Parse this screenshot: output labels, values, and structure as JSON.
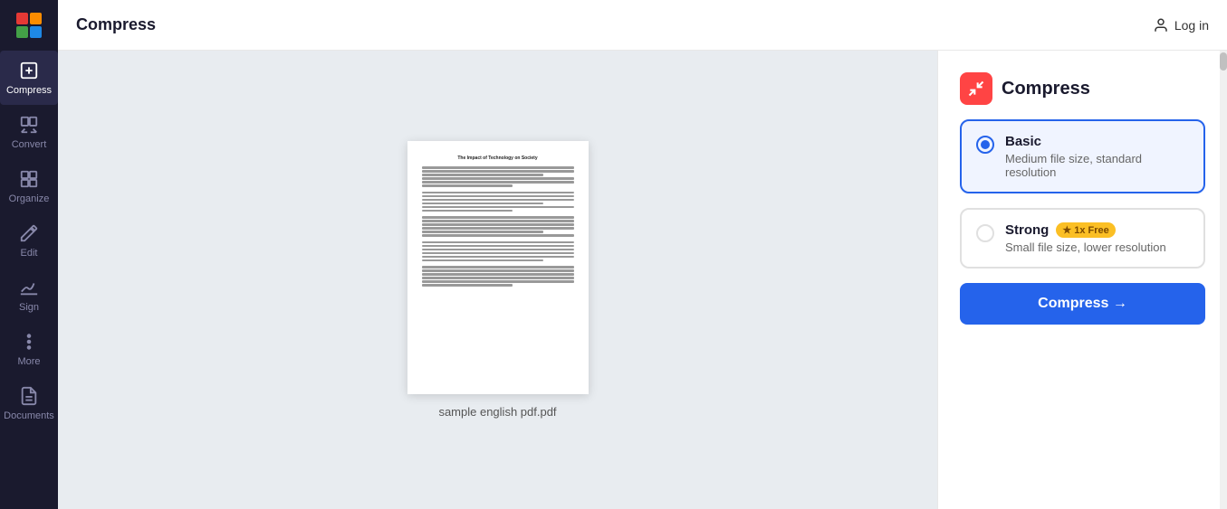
{
  "header": {
    "title": "Compress",
    "login_label": "Log in"
  },
  "sidebar": {
    "items": [
      {
        "id": "compress",
        "label": "Compress",
        "active": true
      },
      {
        "id": "convert",
        "label": "Convert",
        "active": false
      },
      {
        "id": "organize",
        "label": "Organize",
        "active": false
      },
      {
        "id": "edit",
        "label": "Edit",
        "active": false
      },
      {
        "id": "sign",
        "label": "Sign",
        "active": false
      },
      {
        "id": "more",
        "label": "More",
        "active": false
      },
      {
        "id": "documents",
        "label": "Documents",
        "active": false
      }
    ]
  },
  "pdf_preview": {
    "filename": "sample english pdf.pdf",
    "doc_title": "The Impact of Technology on Society"
  },
  "right_panel": {
    "title": "Compress",
    "options": [
      {
        "id": "basic",
        "label": "Basic",
        "desc": "Medium file size, standard resolution",
        "selected": true,
        "badge": null
      },
      {
        "id": "strong",
        "label": "Strong",
        "desc": "Small file size, lower resolution",
        "selected": false,
        "badge": "★ 1x Free"
      }
    ],
    "compress_button_label": "Compress →"
  }
}
